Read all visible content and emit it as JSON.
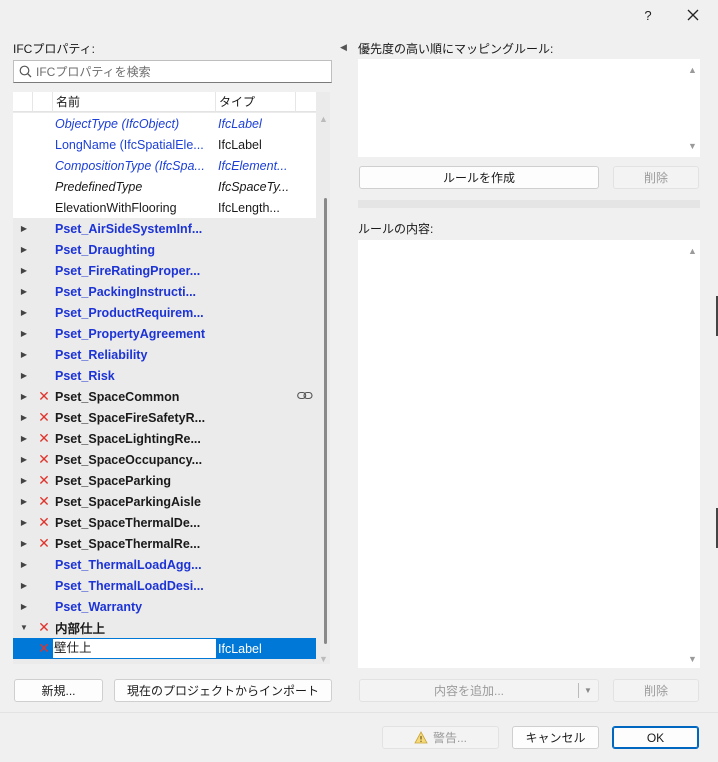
{
  "titlebar": {
    "help": "?",
    "close": "✕"
  },
  "left": {
    "section_label": "IFCプロパティ:",
    "search_placeholder": "IFCプロパティを検索",
    "columns": {
      "name": "名前",
      "type": "タイプ"
    },
    "rows": [
      {
        "name": "ObjectType (IfcObject)",
        "type": "IfcLabel",
        "style": "i-blue",
        "bg": "white",
        "expander": "",
        "x": false
      },
      {
        "name": "LongName (IfcSpatialEle...",
        "type": "IfcLabel",
        "style": "plain-blue",
        "bg": "white",
        "expander": "",
        "x": false
      },
      {
        "name": "CompositionType (IfcSpa...",
        "type": "IfcElement...",
        "style": "i-blue",
        "bg": "white",
        "expander": "",
        "x": false
      },
      {
        "name": "PredefinedType",
        "type": "IfcSpaceTy...",
        "style": "i-black",
        "bg": "white",
        "expander": "",
        "x": false
      },
      {
        "name": "ElevationWithFlooring",
        "type": "IfcLength...",
        "style": "plain",
        "bg": "white",
        "expander": "",
        "x": false
      },
      {
        "name": "Pset_AirSideSystemInf...",
        "type": "",
        "style": "b-blue",
        "bg": "grey",
        "expander": "▶",
        "x": false
      },
      {
        "name": "Pset_Draughting",
        "type": "",
        "style": "b-blue",
        "bg": "grey",
        "expander": "▶",
        "x": false
      },
      {
        "name": "Pset_FireRatingProper...",
        "type": "",
        "style": "b-blue",
        "bg": "grey",
        "expander": "▶",
        "x": false
      },
      {
        "name": "Pset_PackingInstructi...",
        "type": "",
        "style": "b-blue",
        "bg": "grey",
        "expander": "▶",
        "x": false
      },
      {
        "name": "Pset_ProductRequirem...",
        "type": "",
        "style": "b-blue",
        "bg": "grey",
        "expander": "▶",
        "x": false
      },
      {
        "name": "Pset_PropertyAgreement",
        "type": "",
        "style": "b-blue",
        "bg": "grey",
        "expander": "▶",
        "x": false
      },
      {
        "name": "Pset_Reliability",
        "type": "",
        "style": "b-blue",
        "bg": "grey",
        "expander": "▶",
        "x": false
      },
      {
        "name": "Pset_Risk",
        "type": "",
        "style": "b-blue",
        "bg": "grey",
        "expander": "▶",
        "x": false
      },
      {
        "name": "Pset_SpaceCommon",
        "type": "",
        "style": "b-black",
        "bg": "grey",
        "expander": "▶",
        "x": true,
        "link": true
      },
      {
        "name": "Pset_SpaceFireSafetyR...",
        "type": "",
        "style": "b-black",
        "bg": "grey",
        "expander": "▶",
        "x": true
      },
      {
        "name": "Pset_SpaceLightingRe...",
        "type": "",
        "style": "b-black",
        "bg": "grey",
        "expander": "▶",
        "x": true
      },
      {
        "name": "Pset_SpaceOccupancy...",
        "type": "",
        "style": "b-black",
        "bg": "grey",
        "expander": "▶",
        "x": true
      },
      {
        "name": "Pset_SpaceParking",
        "type": "",
        "style": "b-black",
        "bg": "grey",
        "expander": "▶",
        "x": true
      },
      {
        "name": "Pset_SpaceParkingAisle",
        "type": "",
        "style": "b-black",
        "bg": "grey",
        "expander": "▶",
        "x": true
      },
      {
        "name": "Pset_SpaceThermalDe...",
        "type": "",
        "style": "b-black",
        "bg": "grey",
        "expander": "▶",
        "x": true
      },
      {
        "name": "Pset_SpaceThermalRe...",
        "type": "",
        "style": "b-black",
        "bg": "grey",
        "expander": "▶",
        "x": true
      },
      {
        "name": "Pset_ThermalLoadAgg...",
        "type": "",
        "style": "b-blue",
        "bg": "grey",
        "expander": "▶",
        "x": false
      },
      {
        "name": "Pset_ThermalLoadDesi...",
        "type": "",
        "style": "b-blue",
        "bg": "grey",
        "expander": "▶",
        "x": false
      },
      {
        "name": "Pset_Warranty",
        "type": "",
        "style": "b-blue",
        "bg": "grey",
        "expander": "▶",
        "x": false
      },
      {
        "name": "内部仕上",
        "type": "",
        "style": "b-black",
        "bg": "grey",
        "expander": "▼",
        "x": true
      },
      {
        "name": "壁仕上",
        "type": "IfcLabel",
        "style": "edit",
        "bg": "sel",
        "expander": "",
        "x": true
      }
    ],
    "btn_new": "新規...",
    "btn_import": "現在のプロジェクトからインポート"
  },
  "right": {
    "rules_label": "優先度の高い順にマッピングルール:",
    "btn_create_rule": "ルールを作成",
    "btn_delete_rule": "削除",
    "content_label": "ルールの内容:",
    "btn_add_content": "内容を追加...",
    "btn_delete_content": "削除"
  },
  "footer": {
    "warning": "警告...",
    "cancel": "キャンセル",
    "ok": "OK"
  },
  "colors": {
    "accent": "#0078d7",
    "pset_blue": "#1c33d6",
    "x_red": "#e0342b"
  }
}
